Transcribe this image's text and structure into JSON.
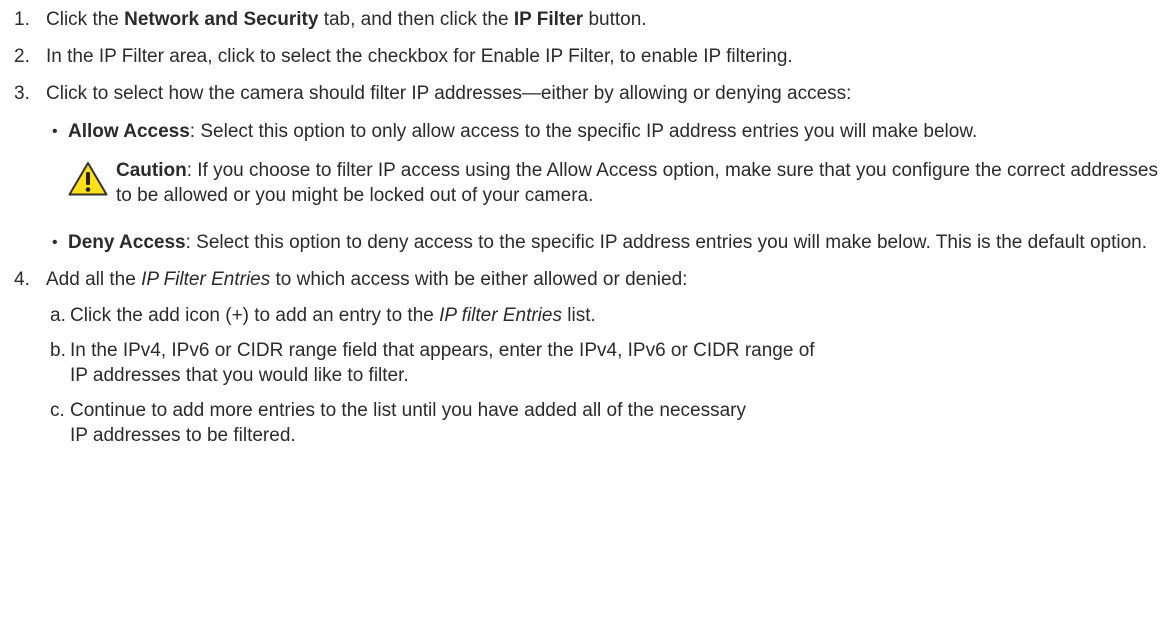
{
  "steps": [
    {
      "num": "1.",
      "t1": "Click the ",
      "b1": "Network and Security",
      "t2": " tab, and then click the ",
      "b2": "IP Filter",
      "t3": " button."
    },
    {
      "num": "2.",
      "text": "In the IP Filter area, click to select the checkbox for Enable IP Filter, to enable IP filtering."
    },
    {
      "num": "3.",
      "text": "Click to select how the camera should filter IP addresses—either by allowing or denying access:",
      "bullets": [
        {
          "dot": "•",
          "label": "Allow Access",
          "text": ": Select this option to only allow access to the specific IP address entries you will make below.",
          "caution": {
            "label": "Caution",
            "text": ": If you choose to filter IP access using the Allow Access option, make sure that you configure the correct addresses to be allowed or you might be locked out of your camera.",
            "icon": "warning-triangle-icon",
            "icon_fill": "#ffde1a",
            "icon_stroke": "#333333"
          }
        },
        {
          "dot": "•",
          "label": "Deny Access",
          "text": ": Select this option to deny access to the specific IP address entries you will make below. This is the default option."
        }
      ]
    },
    {
      "num": "4.",
      "t1": "Add all the ",
      "i1": "IP Filter Entries",
      "t2": " to which access with be either allowed or denied:",
      "substeps": [
        {
          "letter": "a.",
          "t1": "Click the add icon (+) to add an entry to the ",
          "i1": "IP filter Entries",
          "t2": " list."
        },
        {
          "letter": "b.",
          "t1": "In the IPv4, IPv6 or CIDR range field that appears, enter the IPv4, IPv6 or CIDR range of",
          "t2": "IP addresses that you would like to filter."
        },
        {
          "letter": "c.",
          "t1": "Continue to add more entries to the list until you have added all of the necessary",
          "t2": "IP addresses to be filtered."
        }
      ]
    }
  ]
}
